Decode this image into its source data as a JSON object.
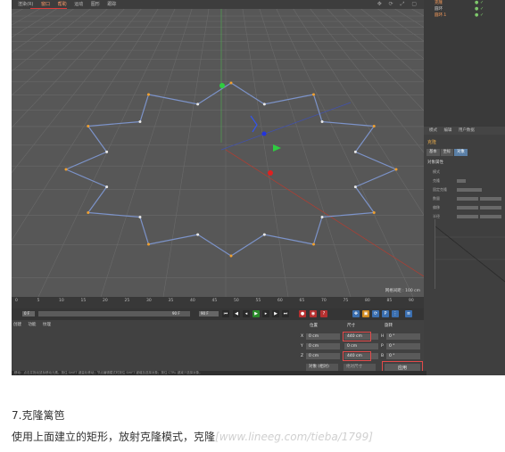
{
  "menubar": {
    "items": [
      "渲染(R)",
      "窗口",
      "帮助",
      "运动",
      "图形",
      "跟踪"
    ],
    "highlighted": [
      "窗口",
      "帮助"
    ]
  },
  "viewport": {
    "label": "网格间距 : 100 cm"
  },
  "object_manager": {
    "items": [
      {
        "name": "克隆"
      },
      {
        "name": "圆环"
      },
      {
        "name": "圆环.1"
      }
    ]
  },
  "attributes": {
    "tabs": [
      "模式",
      "编辑",
      "用户数据"
    ],
    "title": "克隆",
    "mode_tabs": [
      "基本",
      "对象",
      "坐标",
      "变换",
      "效果器"
    ],
    "selected_mode": "对象",
    "section": "对象属性",
    "fields": [
      "模式",
      "克隆",
      "固定克隆",
      "数量",
      "偏移",
      "半径",
      "宽度",
      "角度",
      "每段",
      "速率"
    ]
  },
  "timeline": {
    "ticks": [
      "0",
      "5",
      "10",
      "15",
      "20",
      "25",
      "30",
      "35",
      "40",
      "45",
      "50",
      "55",
      "60",
      "65",
      "70",
      "75",
      "80",
      "85",
      "90"
    ],
    "current_frame": "0 F",
    "start_frame": "0 F",
    "end_frame": "90 F",
    "max_frame": "90 F",
    "fps": "0 F"
  },
  "bottom_tabs": [
    "创建",
    "功能",
    "纹理"
  ],
  "coords": {
    "headers": [
      "位置",
      "尺寸",
      "旋转"
    ],
    "rows": [
      {
        "axis": "X",
        "pos": "0 cm",
        "size": "440 cm",
        "rot_axis": "H",
        "rot": "0 °"
      },
      {
        "axis": "Y",
        "pos": "0 cm",
        "size": "0 cm",
        "rot_axis": "P",
        "rot": "0 °"
      },
      {
        "axis": "Z",
        "pos": "0 cm",
        "size": "440 cm",
        "rot_axis": "B",
        "rot": "0 °"
      }
    ],
    "object_dropdown": "对象 (相对)",
    "absolute_dropdown": "绝对尺寸",
    "apply_label": "应用"
  },
  "status_text": "移动：点击并拖动鼠标移动元素。按住 SHIFT 键量化移动；节点编辑模式时按住 SHIFT 键增加选择对象；按住 CTRL 键减少选择对象。",
  "caption": {
    "title": "7.克隆篱笆",
    "body": "使用上面建立的矩形，放射克隆模式，克隆",
    "watermark": "[www.lineeg.com/tieba/1799]"
  },
  "colors": {
    "viewport_bg": "#5a5a5a",
    "grid": "#6b6b6b",
    "spline_blue": "#6f8fd0",
    "spline_white": "#e8e8e8",
    "point_orange": "#f0a030",
    "highlight_red": "#e24a4a",
    "accent_orange": "#ff9f5c"
  }
}
